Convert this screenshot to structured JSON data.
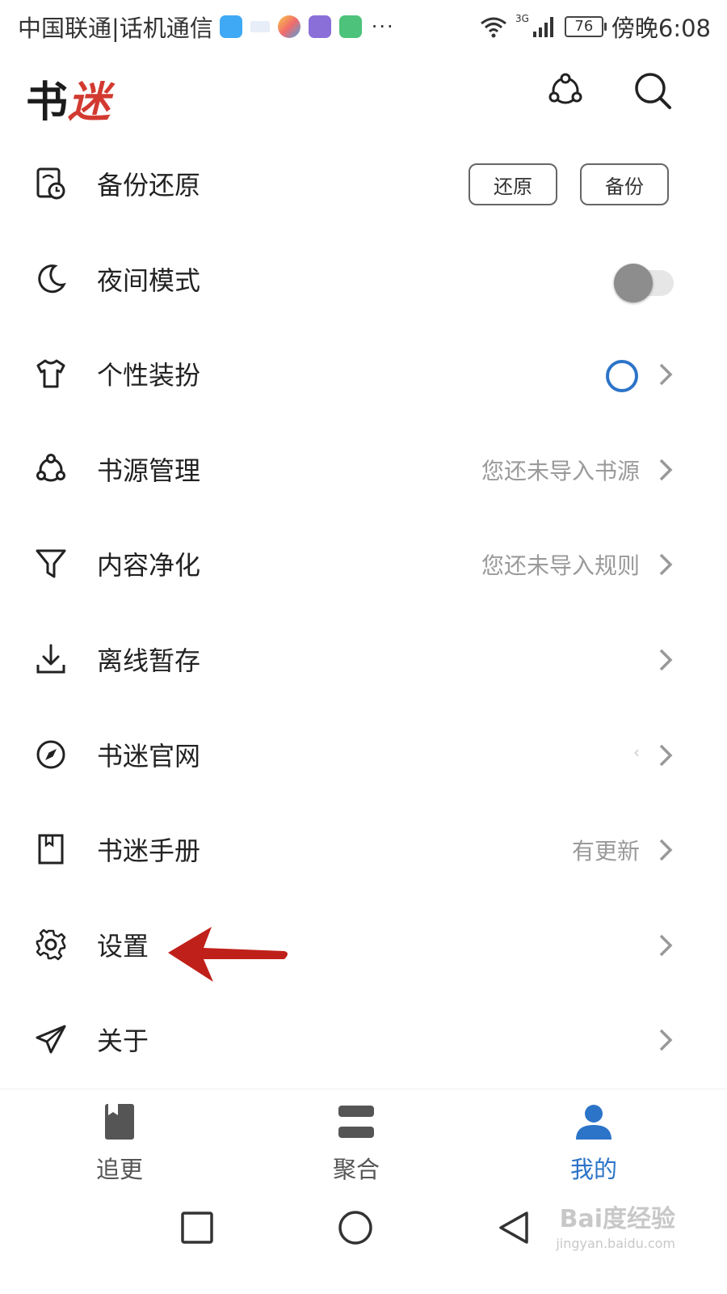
{
  "status_bar": {
    "carrier": "中国联通|话机通信",
    "more": "···",
    "network": "3G",
    "battery": "76",
    "time": "傍晚6:08"
  },
  "header": {
    "logo_char1": "书",
    "logo_char2": "迷"
  },
  "menu": {
    "backup": {
      "label": "备份还原",
      "restore_btn": "还原",
      "backup_btn": "备份"
    },
    "night": {
      "label": "夜间模式",
      "enabled": false
    },
    "theme": {
      "label": "个性装扮"
    },
    "source": {
      "label": "书源管理",
      "hint": "您还未导入书源"
    },
    "purify": {
      "label": "内容净化",
      "hint": "您还未导入规则"
    },
    "offline": {
      "label": "离线暂存"
    },
    "website": {
      "label": "书迷官网"
    },
    "manual": {
      "label": "书迷手册",
      "hint": "有更新"
    },
    "settings": {
      "label": "设置"
    },
    "about": {
      "label": "关于"
    }
  },
  "tabs": [
    {
      "label": "追更",
      "active": false
    },
    {
      "label": "聚合",
      "active": false
    },
    {
      "label": "我的",
      "active": true
    }
  ],
  "watermark": {
    "brand": "Bai度经验",
    "url": "jingyan.baidu.com"
  },
  "colors": {
    "accent": "#2c74c8",
    "logo_red": "#d23a30",
    "arrow": "#c0201a",
    "hint_gray": "#9a9a9a"
  }
}
